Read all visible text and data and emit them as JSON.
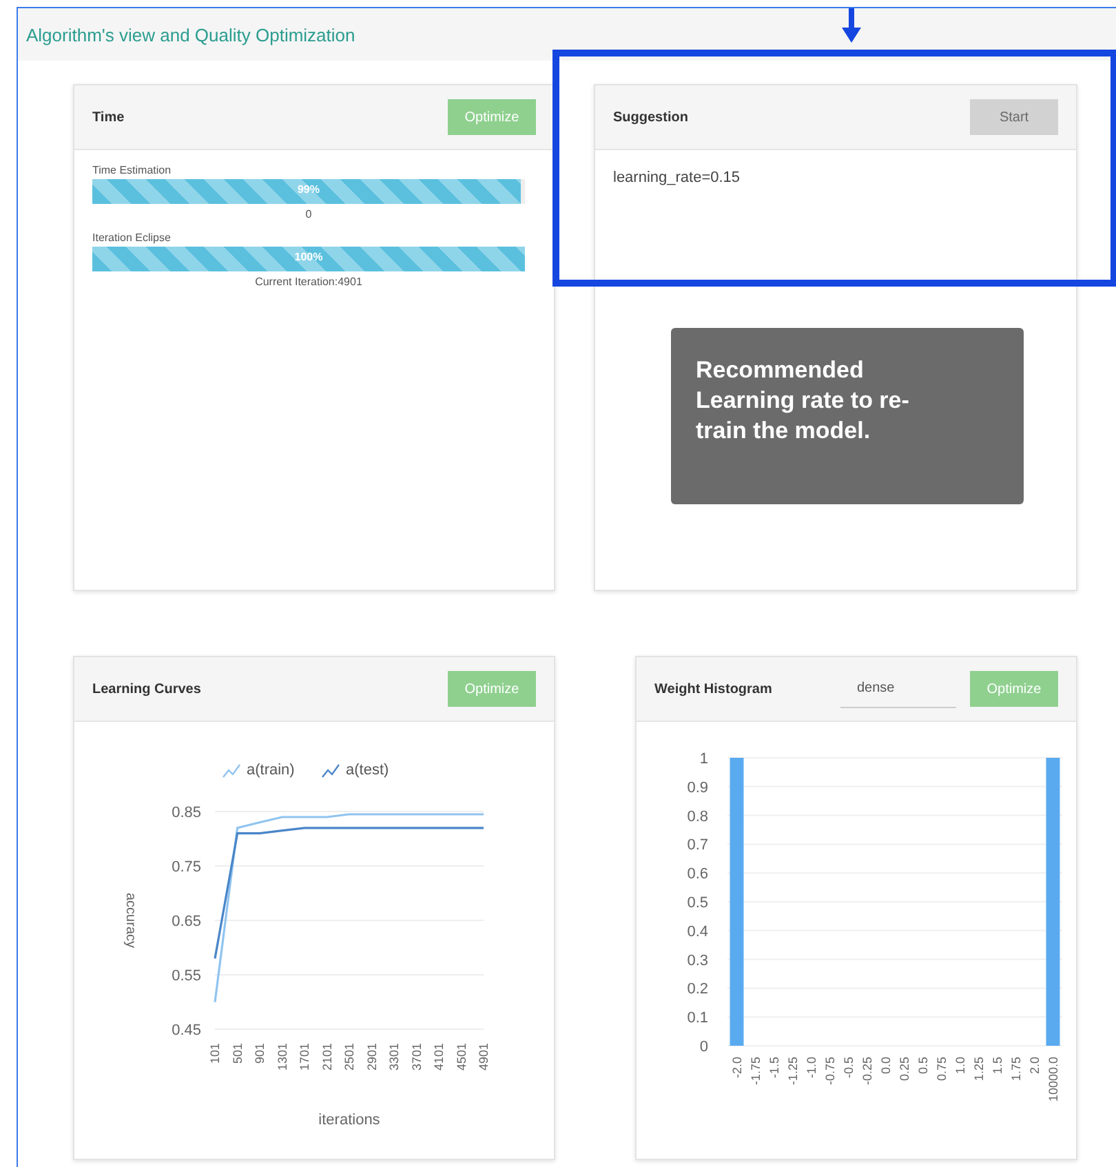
{
  "page": {
    "title": "Algorithm's view and Quality Optimization"
  },
  "time_card": {
    "title": "Time",
    "button": {
      "label": "Optimize",
      "disabled": false
    },
    "progress": [
      {
        "label": "Time Estimation",
        "level": 0.99,
        "reading": "99%",
        "caption": "0"
      },
      {
        "label": "Iteration Eclipse",
        "level": 1,
        "reading": "100%",
        "caption": "Current Iteration:4901"
      }
    ]
  },
  "suggestion_card": {
    "title": "Suggestion",
    "button": {
      "label": "Start",
      "disabled": true
    },
    "text": "learning_rate=0.15"
  },
  "callout": {
    "text": "Recommended Learning rate to re-train the model."
  },
  "learning_card": {
    "title": "Learning Curves",
    "button": {
      "label": "Optimize",
      "disabled": false
    },
    "chart_data": {
      "type": "line",
      "xlabel": "iterations",
      "ylabel": "accuracy",
      "categories": [
        "101",
        "501",
        "901",
        "1301",
        "1701",
        "2101",
        "2501",
        "2901",
        "3301",
        "3701",
        "4101",
        "4501",
        "4901"
      ],
      "series": [
        {
          "name": "a(train)",
          "color": "#90c4f0",
          "values": [
            0.5,
            0.82,
            0.83,
            0.84,
            0.84,
            0.84,
            0.845,
            0.845,
            0.845,
            0.845,
            0.845,
            0.845,
            0.845
          ]
        },
        {
          "name": "a(test)",
          "color": "#4a86c8",
          "values": [
            0.58,
            0.81,
            0.81,
            0.815,
            0.82,
            0.82,
            0.82,
            0.82,
            0.82,
            0.82,
            0.82,
            0.82,
            0.82
          ]
        }
      ],
      "ylim": [
        0.45,
        0.85
      ],
      "yticks": [
        0.45,
        0.55,
        0.65,
        0.75,
        0.85
      ],
      "grid": true,
      "legend": "top"
    }
  },
  "histogram_card": {
    "title": "Weight Histogram",
    "select": {
      "value": "dense"
    },
    "button": {
      "label": "Optimize",
      "disabled": false
    },
    "chart_data": {
      "type": "bar",
      "categories": [
        "-2.0",
        "-1.75",
        "-1.5",
        "-1.25",
        "-1.0",
        "-0.75",
        "-0.5",
        "-0.25",
        "0.0",
        "0.25",
        "0.5",
        "0.75",
        "1.0",
        "1.25",
        "1.5",
        "1.75",
        "2.0",
        "10000.0"
      ],
      "grid": true,
      "series": [
        {
          "color": "#5aaaf0",
          "values": [
            1,
            0,
            0,
            0,
            0,
            0,
            0,
            0,
            0,
            0,
            0,
            0,
            0,
            0,
            0,
            0,
            0,
            1
          ]
        }
      ],
      "ylim": [
        0,
        1
      ],
      "yticks": [
        {
          "value": 0,
          "label": "0"
        },
        {
          "value": 0.1,
          "label": "0.1"
        },
        {
          "value": 0.2,
          "label": "0.2"
        },
        {
          "value": 0.3,
          "label": "0.3"
        },
        {
          "value": 0.4,
          "label": "0.4"
        },
        {
          "value": 0.5,
          "label": "0.5"
        },
        {
          "value": 0.6,
          "label": "0.6"
        },
        {
          "value": 0.7,
          "label": "0.7"
        },
        {
          "value": 0.8,
          "label": "0.8"
        },
        {
          "value": 0.9,
          "label": "0.9"
        },
        {
          "value": 1,
          "label": "1"
        }
      ]
    }
  }
}
